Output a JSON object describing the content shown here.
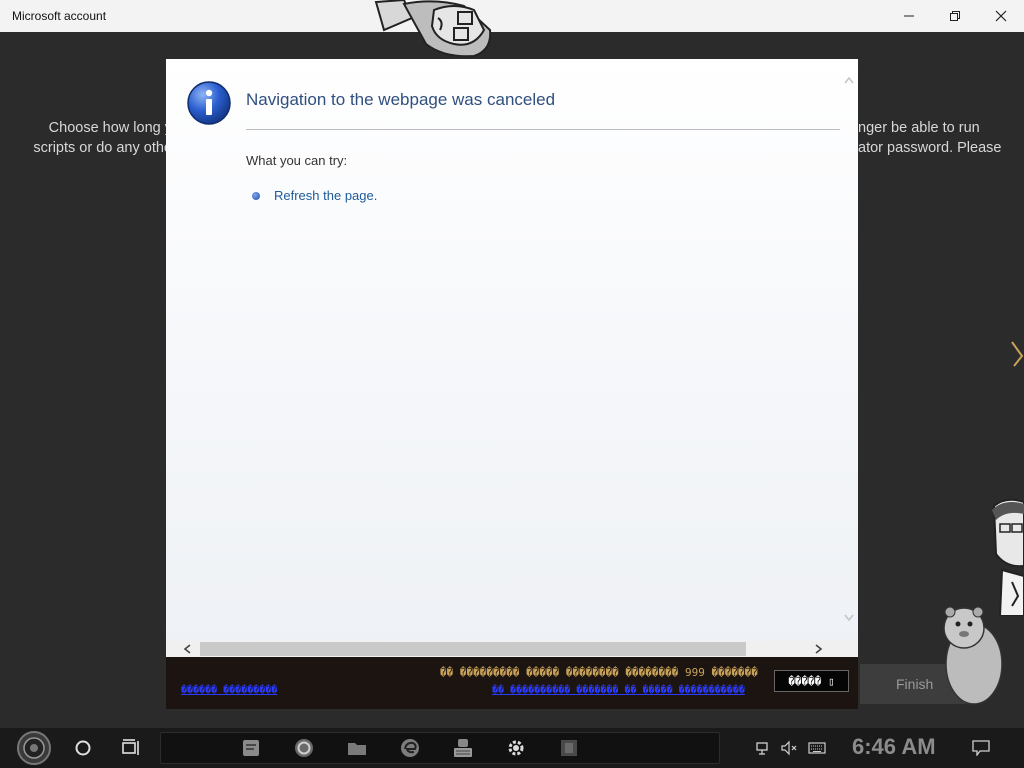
{
  "window": {
    "title": "Microsoft account"
  },
  "background_page": {
    "text_left": "Choose how long y\nscripts or do any othe",
    "text_right": "nger be able to run\nator password. Please",
    "finish_label": "Finish"
  },
  "dialog": {
    "title": "Navigation to the webpage was canceled",
    "subtitle": "What you can try:",
    "link_text": "Refresh the page."
  },
  "footer": {
    "warning_text": "�� ��������� ����� �������� �������� 999 �������",
    "link_left": "������ ���������",
    "link_right": "�� ���������� ������� �� ����� �����������",
    "button_label": "����� ▯"
  },
  "taskbar": {
    "clock": "6:46 AM"
  },
  "colors": {
    "title_blue": "#2f4f7f",
    "link_blue": "#1f5a9a",
    "footer_bg": "#1c1410",
    "footer_warning": "#c9a25a",
    "footer_link": "#2b3bff"
  },
  "icons": [
    "minimize-icon",
    "restore-icon",
    "close-icon",
    "info-icon",
    "search-circle-icon",
    "task-view-icon",
    "notes-icon",
    "cortana-icon",
    "folder-icon",
    "edge-icon",
    "keyboard-app-icon",
    "settings-icon",
    "store-icon",
    "network-icon",
    "volume-muted-icon",
    "keyboard-icon",
    "notification-icon"
  ]
}
